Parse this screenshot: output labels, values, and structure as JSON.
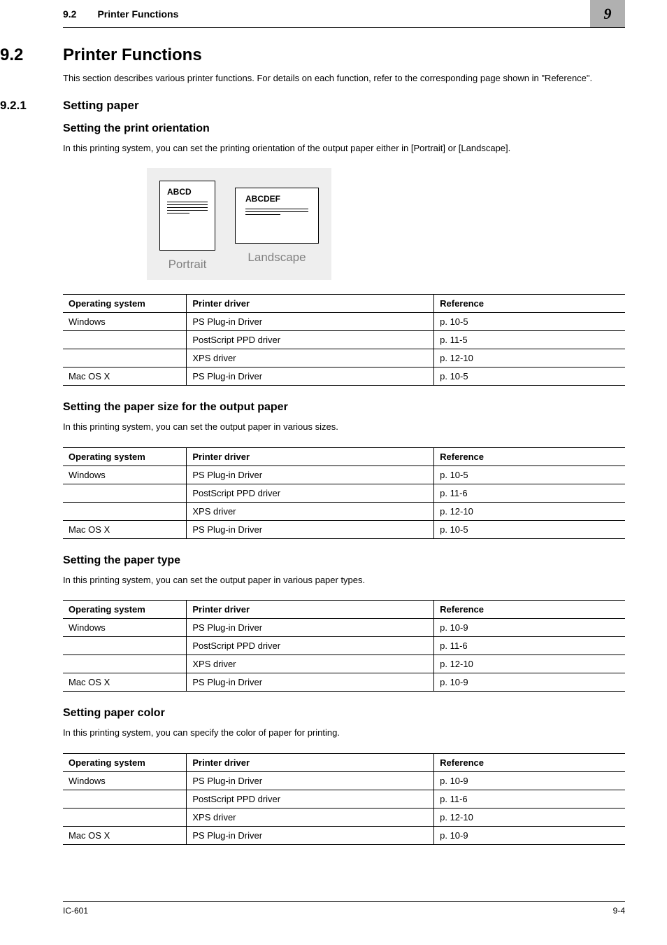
{
  "header": {
    "section_number": "9.2",
    "section_title_short": "Printer Functions",
    "chapter_number": "9"
  },
  "h1": {
    "number": "9.2",
    "title": "Printer Functions"
  },
  "intro": "This section describes various printer functions. For details on each function, refer to the corresponding page shown in \"Reference\".",
  "h2": {
    "number": "9.2.1",
    "title": "Setting paper"
  },
  "s1": {
    "heading": "Setting the print orientation",
    "para": "In this printing system, you can set the printing orientation of the output paper either in [Portrait] or [Landscape].",
    "illus": {
      "portrait_label": "ABCD",
      "landscape_label": "ABCDEF",
      "portrait_caption": "Portrait",
      "landscape_caption": "Landscape"
    },
    "table": {
      "headers": {
        "os": "Operating system",
        "driver": "Printer driver",
        "ref": "Reference"
      },
      "rows": [
        {
          "os": "Windows",
          "driver": "PS Plug-in Driver",
          "ref": "p. 10-5"
        },
        {
          "os": "",
          "driver": "PostScript PPD driver",
          "ref": "p. 11-5"
        },
        {
          "os": "",
          "driver": "XPS driver",
          "ref": "p. 12-10"
        },
        {
          "os": "Mac OS X",
          "driver": "PS Plug-in Driver",
          "ref": "p. 10-5"
        }
      ]
    }
  },
  "s2": {
    "heading": "Setting the paper size for the output paper",
    "para": "In this printing system, you can set the output paper in various sizes.",
    "table": {
      "headers": {
        "os": "Operating system",
        "driver": "Printer driver",
        "ref": "Reference"
      },
      "rows": [
        {
          "os": "Windows",
          "driver": "PS Plug-in Driver",
          "ref": "p. 10-5"
        },
        {
          "os": "",
          "driver": "PostScript PPD driver",
          "ref": "p. 11-6"
        },
        {
          "os": "",
          "driver": "XPS driver",
          "ref": "p. 12-10"
        },
        {
          "os": "Mac OS X",
          "driver": "PS Plug-in Driver",
          "ref": "p. 10-5"
        }
      ]
    }
  },
  "s3": {
    "heading": "Setting the paper type",
    "para": "In this printing system, you can set the output paper in various paper types.",
    "table": {
      "headers": {
        "os": "Operating system",
        "driver": "Printer driver",
        "ref": "Reference"
      },
      "rows": [
        {
          "os": "Windows",
          "driver": "PS Plug-in Driver",
          "ref": "p. 10-9"
        },
        {
          "os": "",
          "driver": "PostScript PPD driver",
          "ref": "p. 11-6"
        },
        {
          "os": "",
          "driver": "XPS driver",
          "ref": "p. 12-10"
        },
        {
          "os": "Mac OS X",
          "driver": "PS Plug-in Driver",
          "ref": "p. 10-9"
        }
      ]
    }
  },
  "s4": {
    "heading": "Setting paper color",
    "para": "In this printing system, you can specify the color of paper for printing.",
    "table": {
      "headers": {
        "os": "Operating system",
        "driver": "Printer driver",
        "ref": "Reference"
      },
      "rows": [
        {
          "os": "Windows",
          "driver": "PS Plug-in Driver",
          "ref": "p. 10-9"
        },
        {
          "os": "",
          "driver": "PostScript PPD driver",
          "ref": "p. 11-6"
        },
        {
          "os": "",
          "driver": "XPS driver",
          "ref": "p. 12-10"
        },
        {
          "os": "Mac OS X",
          "driver": "PS Plug-in Driver",
          "ref": "p. 10-9"
        }
      ]
    }
  },
  "footer": {
    "left": "IC-601",
    "right": "9-4"
  }
}
